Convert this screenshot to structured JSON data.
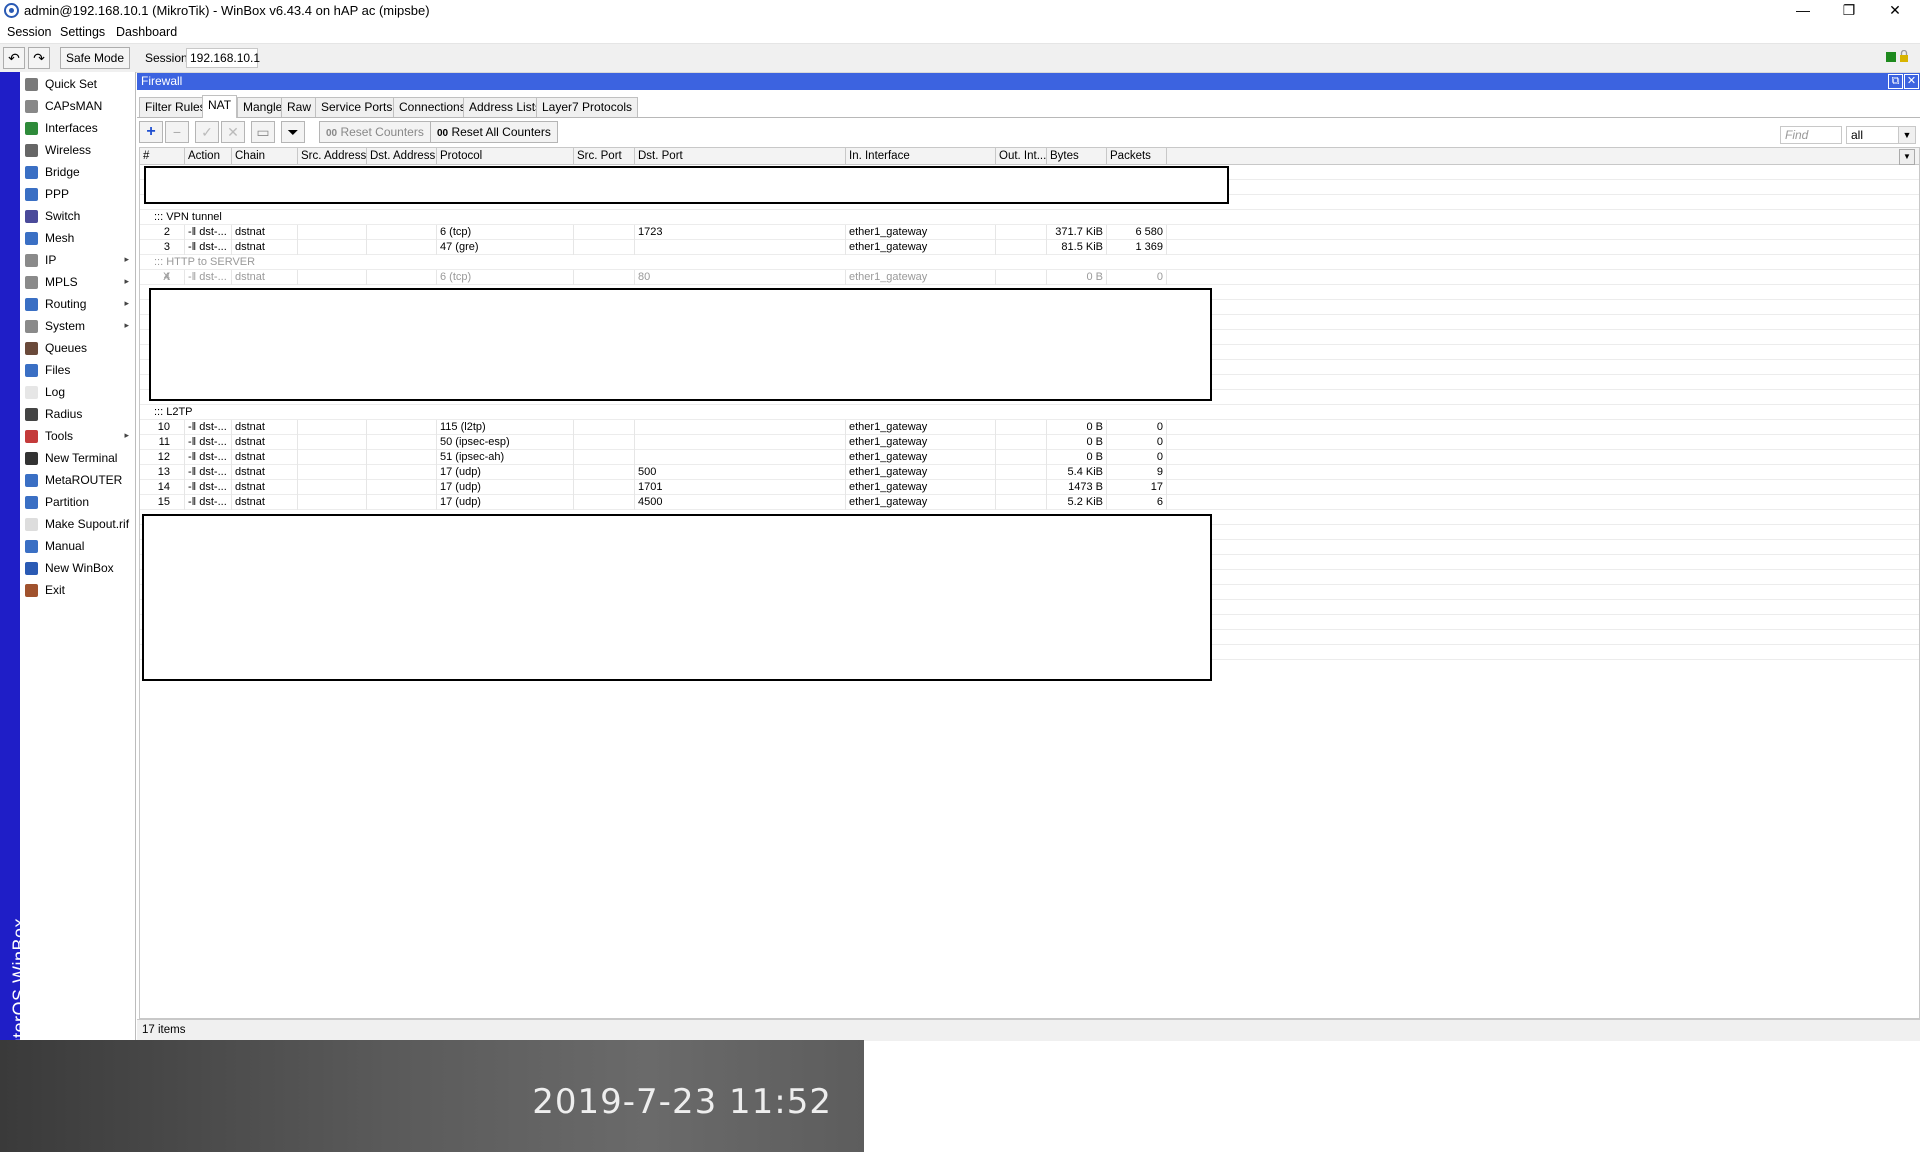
{
  "window": {
    "title": "admin@192.168.10.1 (MikroTik) - WinBox v6.43.4 on hAP ac (mipsbe)",
    "minimize": "—",
    "maximize": "❐",
    "close": "✕"
  },
  "menu": [
    "Session",
    "Settings",
    "Dashboard"
  ],
  "toolbar": {
    "undo": "↶",
    "redo": "↷",
    "safe_mode": "Safe Mode",
    "session_label": "Session:",
    "session_value": "192.168.10.1"
  },
  "side_strip_text": "RouterOS WinBox",
  "sidebar": {
    "items": [
      {
        "label": "Quick Set",
        "icon": "quick-set-icon",
        "color": "#7a7a7a",
        "arrow": false
      },
      {
        "label": "CAPsMAN",
        "icon": "capsman-icon",
        "color": "#888888",
        "arrow": false
      },
      {
        "label": "Interfaces",
        "icon": "interfaces-icon",
        "color": "#2e8b3a",
        "arrow": false
      },
      {
        "label": "Wireless",
        "icon": "wireless-icon",
        "color": "#666666",
        "arrow": false
      },
      {
        "label": "Bridge",
        "icon": "bridge-icon",
        "color": "#3a6fc4",
        "arrow": false
      },
      {
        "label": "PPP",
        "icon": "ppp-icon",
        "color": "#3a6fc4",
        "arrow": false
      },
      {
        "label": "Switch",
        "icon": "switch-icon",
        "color": "#4a4a9a",
        "arrow": false
      },
      {
        "label": "Mesh",
        "icon": "mesh-icon",
        "color": "#3a6fc4",
        "arrow": false
      },
      {
        "label": "IP",
        "icon": "ip-icon",
        "color": "#8a8a8a",
        "arrow": true
      },
      {
        "label": "MPLS",
        "icon": "mpls-icon",
        "color": "#8a8a8a",
        "arrow": true
      },
      {
        "label": "Routing",
        "icon": "routing-icon",
        "color": "#3a6fc4",
        "arrow": true
      },
      {
        "label": "System",
        "icon": "system-icon",
        "color": "#8a8a8a",
        "arrow": true
      },
      {
        "label": "Queues",
        "icon": "queues-icon",
        "color": "#6a4a3a",
        "arrow": false
      },
      {
        "label": "Files",
        "icon": "files-icon",
        "color": "#3a6fc4",
        "arrow": false
      },
      {
        "label": "Log",
        "icon": "log-icon",
        "color": "#e6e6e6",
        "arrow": false
      },
      {
        "label": "Radius",
        "icon": "radius-icon",
        "color": "#444444",
        "arrow": false
      },
      {
        "label": "Tools",
        "icon": "tools-icon",
        "color": "#c43a3a",
        "arrow": true
      },
      {
        "label": "New Terminal",
        "icon": "terminal-icon",
        "color": "#333333",
        "arrow": false
      },
      {
        "label": "MetaROUTER",
        "icon": "metarouter-icon",
        "color": "#3a6fc4",
        "arrow": false
      },
      {
        "label": "Partition",
        "icon": "partition-icon",
        "color": "#3a6fc4",
        "arrow": false
      },
      {
        "label": "Make Supout.rif",
        "icon": "supout-icon",
        "color": "#dddddd",
        "arrow": false
      },
      {
        "label": "Manual",
        "icon": "manual-icon",
        "color": "#3a6fc4",
        "arrow": false
      },
      {
        "label": "New WinBox",
        "icon": "winbox-icon",
        "color": "#2a5ab4",
        "arrow": false
      },
      {
        "label": "Exit",
        "icon": "exit-icon",
        "color": "#a0522d",
        "arrow": false
      }
    ]
  },
  "firewall": {
    "title": "Firewall",
    "restore": "⧉",
    "close": "✕",
    "tabs": [
      "Filter Rules",
      "NAT",
      "Mangle",
      "Raw",
      "Service Ports",
      "Connections",
      "Address Lists",
      "Layer7 Protocols"
    ],
    "active_tab": 1,
    "tools": {
      "add": "+",
      "remove": "−",
      "enable": "✓",
      "disable": "✕",
      "comment": "▭",
      "filter": "⏷",
      "reset_counters": "Reset Counters",
      "reset_all_counters": "Reset All Counters",
      "counter_glyph": "00",
      "find_placeholder": "Find",
      "filter_value": "all",
      "dropdown": "▼"
    },
    "columns": [
      "#",
      "Action",
      "Chain",
      "Src. Address",
      "Dst. Address",
      "Protocol",
      "Src. Port",
      "Dst. Port",
      "In. Interface",
      "Out. Int...",
      "Bytes",
      "Packets"
    ],
    "comments": {
      "vpn": "::: VPN tunnel",
      "http": "::: HTTP to SERVER",
      "l2tp": "::: L2TP"
    },
    "rows_vpn": [
      {
        "num": "2",
        "flag": "",
        "action": "-‖ dst-...",
        "chain": "dstnat",
        "protocol": "6 (tcp)",
        "dst_port": "1723",
        "in_if": "ether1_gateway",
        "bytes": "371.7 KiB",
        "packets": "6 580"
      },
      {
        "num": "3",
        "flag": "",
        "action": "-‖ dst-...",
        "chain": "dstnat",
        "protocol": "47 (gre)",
        "dst_port": "",
        "in_if": "ether1_gateway",
        "bytes": "81.5 KiB",
        "packets": "1 369"
      }
    ],
    "rows_http": [
      {
        "num": "4",
        "flag": "X",
        "action": "-‖ dst-...",
        "chain": "dstnat",
        "protocol": "6 (tcp)",
        "dst_port": "80",
        "in_if": "ether1_gateway",
        "bytes": "0 B",
        "packets": "0"
      }
    ],
    "rows_l2tp": [
      {
        "num": "10",
        "flag": "",
        "action": "-‖ dst-...",
        "chain": "dstnat",
        "protocol": "115 (l2tp)",
        "dst_port": "",
        "in_if": "ether1_gateway",
        "bytes": "0 B",
        "packets": "0"
      },
      {
        "num": "11",
        "flag": "",
        "action": "-‖ dst-...",
        "chain": "dstnat",
        "protocol": "50 (ipsec-esp)",
        "dst_port": "",
        "in_if": "ether1_gateway",
        "bytes": "0 B",
        "packets": "0"
      },
      {
        "num": "12",
        "flag": "",
        "action": "-‖ dst-...",
        "chain": "dstnat",
        "protocol": "51 (ipsec-ah)",
        "dst_port": "",
        "in_if": "ether1_gateway",
        "bytes": "0 B",
        "packets": "0"
      },
      {
        "num": "13",
        "flag": "",
        "action": "-‖ dst-...",
        "chain": "dstnat",
        "protocol": "17 (udp)",
        "dst_port": "500",
        "in_if": "ether1_gateway",
        "bytes": "5.4 KiB",
        "packets": "9"
      },
      {
        "num": "14",
        "flag": "",
        "action": "-‖ dst-...",
        "chain": "dstnat",
        "protocol": "17 (udp)",
        "dst_port": "1701",
        "in_if": "ether1_gateway",
        "bytes": "1473 B",
        "packets": "17"
      },
      {
        "num": "15",
        "flag": "",
        "action": "-‖ dst-...",
        "chain": "dstnat",
        "protocol": "17 (udp)",
        "dst_port": "4500",
        "in_if": "ether1_gateway",
        "bytes": "5.2 KiB",
        "packets": "6"
      }
    ],
    "status": "17 items"
  },
  "timestamp": "2019-7-23  11:52",
  "colors": {
    "header_blue": "#3c63e0",
    "side_strip": "#1f1ec7"
  }
}
